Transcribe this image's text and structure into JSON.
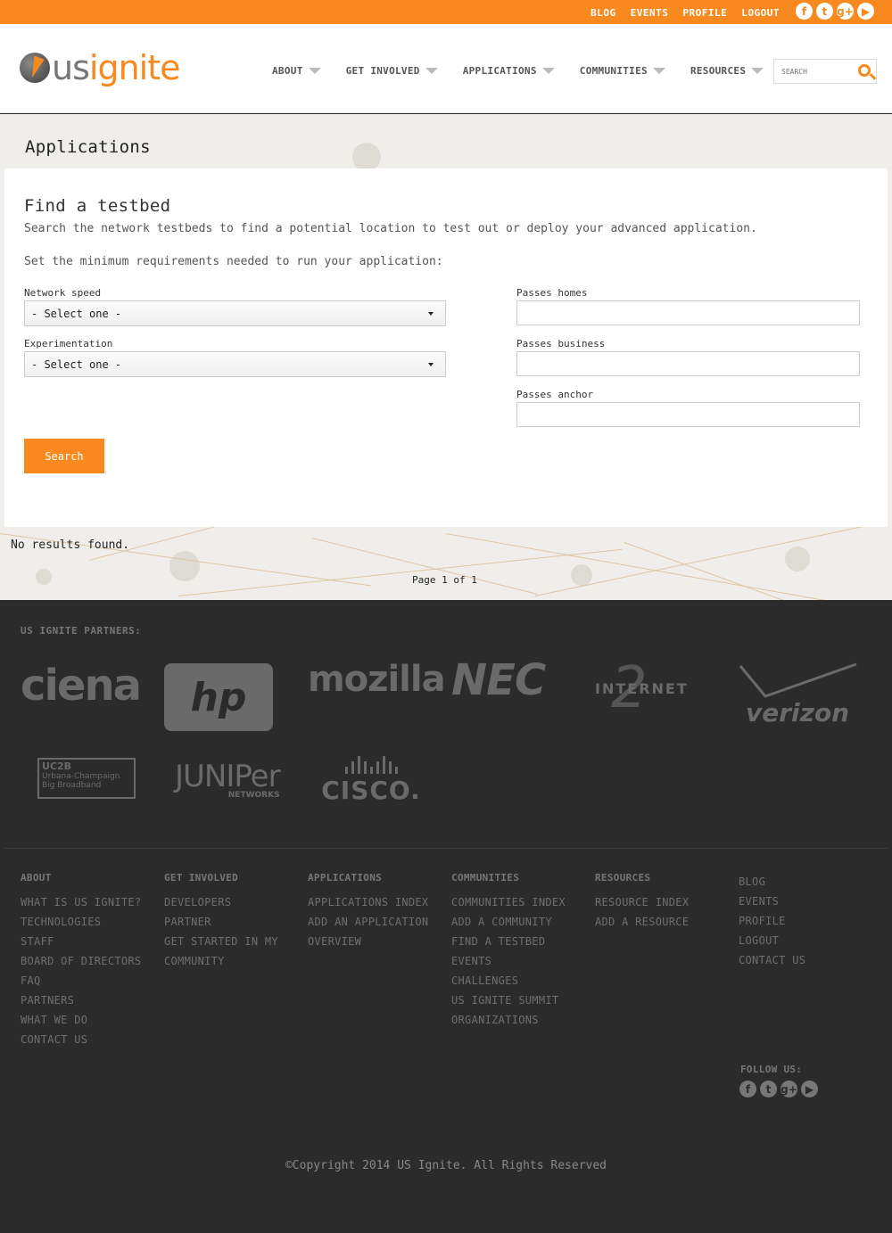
{
  "topbar": {
    "links": [
      "BLOG",
      "EVENTS",
      "PROFILE",
      "LOGOUT"
    ],
    "social": [
      "facebook-icon",
      "twitter-icon",
      "google-plus-icon",
      "youtube-icon"
    ],
    "color": "#f7891f"
  },
  "header": {
    "logo": {
      "us": "us",
      "ignite": "ignite"
    },
    "nav": [
      "ABOUT",
      "GET INVOLVED",
      "APPLICATIONS",
      "COMMUNITIES",
      "RESOURCES"
    ],
    "search_placeholder": "SEARCH"
  },
  "page": {
    "title": "Applications"
  },
  "panel": {
    "heading": "Find a testbed",
    "description": "Search the network testbeds to find a potential location to test out or deploy your advanced application.",
    "requirements": "Set the minimum requirements needed to run your application:",
    "network_speed": {
      "label": "Network speed",
      "value": "- Select one -"
    },
    "experimentation": {
      "label": "Experimentation",
      "value": "- Select one -"
    },
    "passes_homes": {
      "label": "Passes homes",
      "value": ""
    },
    "passes_business": {
      "label": "Passes business",
      "value": ""
    },
    "passes_anchor": {
      "label": "Passes anchor",
      "value": ""
    },
    "search_label": "Search"
  },
  "results": {
    "message": "No results found.",
    "pager": "Page 1 of 1"
  },
  "footer": {
    "partners_title": "US IGNITE PARTNERS:",
    "partners": {
      "ciena": "ciena",
      "hp": "hp",
      "mozilla": "mozilla",
      "nec": "NEC",
      "internet2": "INTERNET",
      "verizon": "verizon",
      "uc2b": {
        "mark": "UC2B",
        "text": "Urbana-Champaign Big Broadband"
      },
      "juniper": {
        "name": "JUNIPer",
        "sub": "NETWORKS"
      },
      "cisco": "CISCO."
    },
    "columns": [
      {
        "heading": "ABOUT",
        "links": [
          "WHAT IS US IGNITE?",
          "TECHNOLOGIES",
          "STAFF",
          "BOARD OF DIRECTORS",
          "FAQ",
          "PARTNERS",
          "WHAT WE DO",
          "CONTACT US"
        ]
      },
      {
        "heading": "GET INVOLVED",
        "links": [
          "DEVELOPERS",
          "PARTNER",
          "GET STARTED IN MY",
          "COMMUNITY"
        ]
      },
      {
        "heading": "APPLICATIONS",
        "links": [
          "APPLICATIONS INDEX",
          "ADD AN APPLICATION",
          "OVERVIEW"
        ]
      },
      {
        "heading": "COMMUNITIES",
        "links": [
          "COMMUNITIES INDEX",
          "ADD A COMMUNITY",
          "FIND A TESTBED",
          "EVENTS",
          "CHALLENGES",
          "US IGNITE SUMMIT",
          "ORGANIZATIONS"
        ]
      },
      {
        "heading": "RESOURCES",
        "links": [
          "RESOURCE INDEX",
          "ADD A RESOURCE"
        ]
      },
      {
        "heading": "",
        "links": [
          "BLOG",
          "EVENTS",
          "PROFILE",
          "LOGOUT",
          "CONTACT US"
        ]
      }
    ],
    "follow_title": "FOLLOW US:",
    "copyright": "©Copyright 2014 US Ignite. All Rights Reserved"
  }
}
